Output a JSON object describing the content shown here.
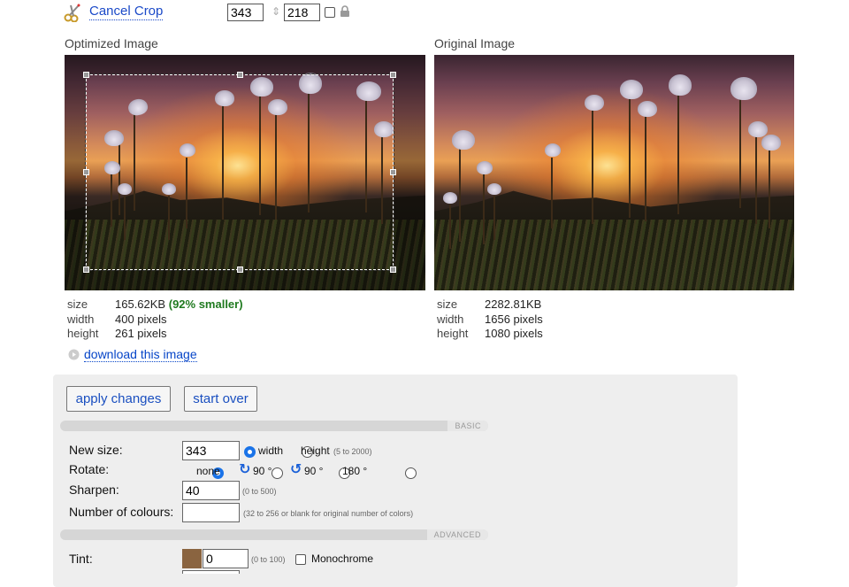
{
  "toolbar": {
    "cancel_crop_label": "Cancel Crop",
    "crop_width": "343",
    "crop_height": "218"
  },
  "optimized": {
    "title": "Optimized Image",
    "size_key": "size",
    "size_value": "165.62KB",
    "size_saving": "(92% smaller)",
    "width_key": "width",
    "width_value": "400 pixels",
    "height_key": "height",
    "height_value": "261 pixels",
    "download_label": "download this image"
  },
  "original": {
    "title": "Original Image",
    "size_key": "size",
    "size_value": "2282.81KB",
    "width_key": "width",
    "width_value": "1656 pixels",
    "height_key": "height",
    "height_value": "1080 pixels"
  },
  "actions": {
    "apply_label": "apply changes",
    "start_over_label": "start over"
  },
  "basic": {
    "section_label": "BASIC",
    "new_size_label": "New size:",
    "new_size_value": "343",
    "width_option": "width",
    "height_option": "height",
    "size_hint": "(5 to 2000)",
    "rotate_label": "Rotate:",
    "rotate_none": "none",
    "rotate_cw": "90 °",
    "rotate_ccw": "90 °",
    "rotate_180": "180 °",
    "sharpen_label": "Sharpen:",
    "sharpen_value": "40",
    "sharpen_hint": "(0 to 500)",
    "colours_label": "Number of colours:",
    "colours_value": "",
    "colours_hint": "(32 to 256 or blank for original number of colors)"
  },
  "advanced": {
    "section_label": "ADVANCED",
    "tint_label": "Tint:",
    "tint_color": "#8a6440",
    "tint_value": "0",
    "tint_hint": "(0 to 100)",
    "monochrome_label": "Monochrome"
  }
}
